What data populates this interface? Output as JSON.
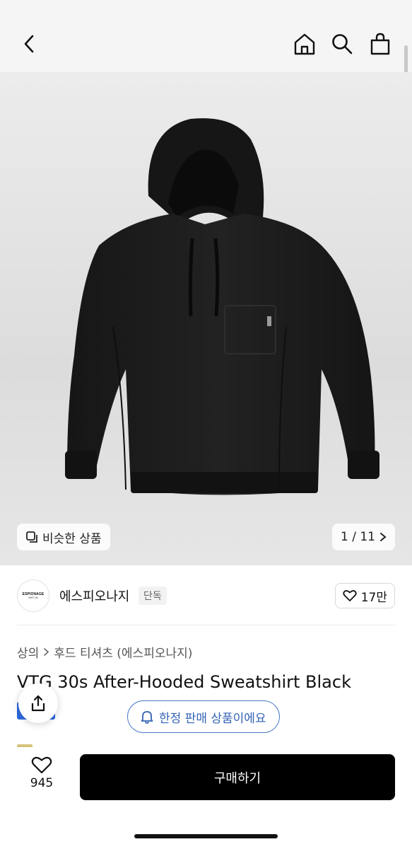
{
  "header": {
    "back_icon": "chevron-left-icon",
    "home_icon": "home-icon",
    "search_icon": "search-icon",
    "bag_icon": "shopping-bag-icon",
    "bg_color": "#f5f5f5"
  },
  "hero": {
    "image_subject": "black hooded sweatshirt",
    "similar_label": "비슷한 상품",
    "similar_icon": "similar-items-icon",
    "counter": "1 / 11",
    "counter_icon": "chevron-right-icon"
  },
  "brand": {
    "logo_text_line1": "ESPIONAGE",
    "logo_text_line2": "INST.'06",
    "name": "에스피오나지",
    "badge": "단독",
    "likes": "17만",
    "like_icon": "heart-outline-icon"
  },
  "breadcrumb": {
    "items": [
      "상의",
      "후드 티셔츠 (에스피오나지)"
    ],
    "separator_icon": "chevron-right-icon"
  },
  "product": {
    "title": "VTG 30s After-Hooded Sweatshirt Black"
  },
  "notice": {
    "limited_label": "한정 판매 상품이에요",
    "bell_icon": "bell-icon",
    "accent_color": "#3463b5"
  },
  "share": {
    "icon": "share-icon"
  },
  "bottom_bar": {
    "wish_icon": "heart-outline-icon",
    "wish_count": "945",
    "buy_label": "구매하기",
    "buy_color": "#000000"
  }
}
